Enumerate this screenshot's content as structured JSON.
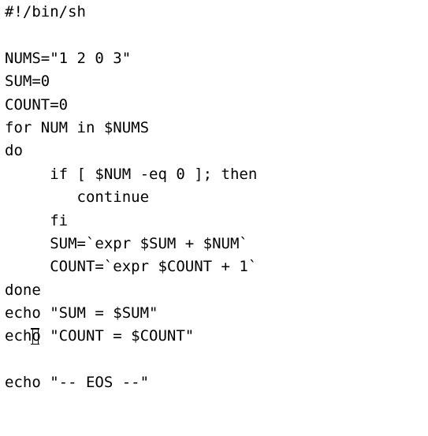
{
  "editor": {
    "lines": [
      "#!/bin/sh",
      "",
      "NUMS=\"1 2 0 3\"",
      "SUM=0",
      "COUNT=0",
      "for NUM in $NUMS",
      "do",
      "     if [ $NUM -eq 0 ]; then",
      "        continue",
      "     fi",
      "     SUM=`expr $SUM + $NUM`",
      "     COUNT=`expr $COUNT + 1`",
      "done",
      "echo \"SUM = $SUM\"",
      "echo \"COUNT = $COUNT\"",
      "",
      "echo \"-- EOS --\""
    ],
    "cursor_line": {
      "before": "ech",
      "char": "o",
      "after": " \"COUNT = $COUNT\""
    },
    "mouse_cursor": "i-beam-cursor"
  }
}
